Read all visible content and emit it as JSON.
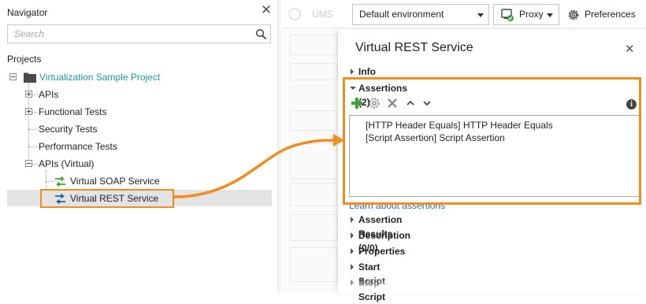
{
  "navigator": {
    "title": "Navigator",
    "search_placeholder": "Search",
    "projects_label": "Projects",
    "tree": {
      "project": "Virtualization Sample Project",
      "apis": "APIs",
      "functional_tests": "Functional Tests",
      "security_tests": "Security Tests",
      "performance_tests": "Performance Tests",
      "apis_virtual": "APIs (Virtual)",
      "virtual_soap": "Virtual SOAP Service",
      "virtual_rest": "Virtual REST Service"
    }
  },
  "toolbar": {
    "ghost_label": "UMS",
    "environment": "Default environment",
    "proxy": "Proxy",
    "preferences": "Preferences"
  },
  "panel": {
    "title": "Virtual REST Service",
    "sections": {
      "info": "Info",
      "assertions": "Assertions (2)",
      "assertion_results": "Assertion Results (0/0)",
      "description": "Description",
      "properties": "Properties",
      "start_script": "Start Script",
      "stop_script": "Stop Script"
    },
    "assertions": [
      "[HTTP Header Equals] HTTP Header Equals",
      "[Script Assertion] Script Assertion"
    ],
    "learn_link": "Learn about assertions"
  },
  "colors": {
    "highlight": "#f28c1e",
    "project_teal": "#1a9aa0",
    "link_blue": "#1f6fb5",
    "add_green": "#3aa335"
  },
  "icons": [
    "close-icon",
    "search-icon",
    "folder-icon",
    "virtual-service-icon",
    "gear-icon",
    "add-icon",
    "delete-icon",
    "arrow-up-icon",
    "arrow-down-icon",
    "info-icon",
    "proxy-icon"
  ]
}
